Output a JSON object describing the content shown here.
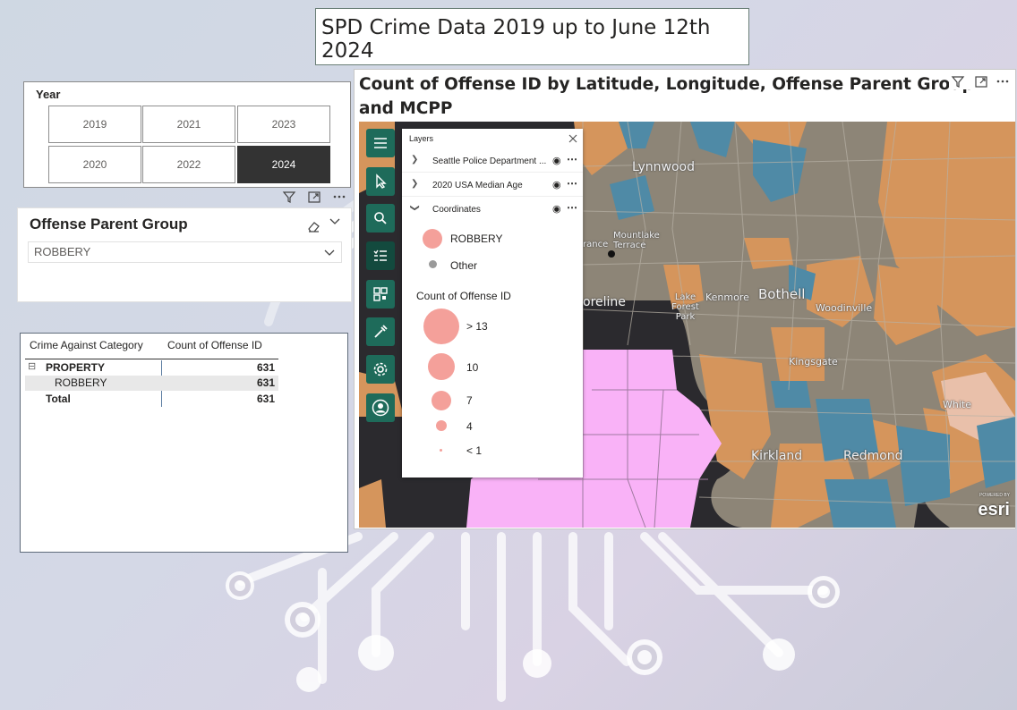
{
  "report_title": "SPD Crime Data  2019 up to June 12th 2024",
  "year_slicer": {
    "label": "Year",
    "options": [
      "2019",
      "2021",
      "2023",
      "2020",
      "2022",
      "2024"
    ],
    "selected": "2024"
  },
  "offense_slicer": {
    "label": "Offense Parent Group",
    "value": "ROBBERY"
  },
  "matrix": {
    "headers": [
      "Crime Against Category",
      "Count of Offense ID"
    ],
    "rows": [
      {
        "label": "PROPERTY",
        "value": "631"
      },
      {
        "label": "ROBBERY",
        "value": "631"
      },
      {
        "label": "Total",
        "value": "631"
      }
    ],
    "expand_icon": "⊟"
  },
  "map": {
    "title": "Count of Offense ID by Latitude, Longitude, Offense Parent Group and MCPP",
    "place_labels": [
      "Lynnwood",
      "Mountlake Terrace",
      "Kenmore",
      "Bothell",
      "Lake Forest Park",
      "Woodinville",
      "oreline",
      "Kingsgate",
      "White",
      "Kirkland",
      "Redmond",
      "rance"
    ],
    "layers_panel": {
      "title": "Layers",
      "layers": [
        "Seattle Police Department ...",
        "2020 USA Median Age",
        "Coordinates"
      ],
      "legend_categories": [
        "ROBBERY",
        "Other"
      ],
      "size_legend_title": "Count of Offense ID",
      "size_legend": [
        "> 13",
        "10",
        "7",
        "4",
        "< 1"
      ]
    },
    "attribution": "esri",
    "attribution_small": "POWERED BY",
    "colors": {
      "orange": "#d5955c",
      "gray": "#8d8577",
      "blue": "#4f8aa6",
      "water": "#2b2a2e",
      "pink": "#f9b2f7",
      "bubble": "#f4a09a",
      "toolbar": "#1e6b5a"
    }
  },
  "icons": [
    "filter-icon",
    "focus-mode-icon",
    "more-options-icon",
    "eraser-icon",
    "chevron-down-icon",
    "menu-icon",
    "select-icon",
    "search-icon",
    "legend-icon",
    "qr-icon",
    "tools-icon",
    "settings-icon",
    "user-icon",
    "close-icon",
    "eye-icon"
  ]
}
